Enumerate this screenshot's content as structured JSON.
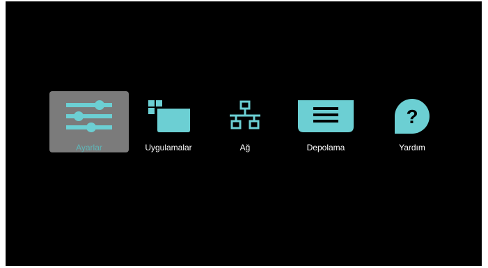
{
  "colors": {
    "background": "#000000",
    "accent": "#6ccfd3",
    "selected_bg": "#7b7b7b",
    "selected_label": "#5fb6b8",
    "label": "#ffffff"
  },
  "menu": {
    "selected_index": 0,
    "items": [
      {
        "label": "Ayarlar",
        "icon": "sliders-icon"
      },
      {
        "label": "Uygulamalar",
        "icon": "apps-icon"
      },
      {
        "label": "Ağ",
        "icon": "network-icon"
      },
      {
        "label": "Depolama",
        "icon": "storage-icon"
      },
      {
        "label": "Yardım",
        "icon": "help-icon"
      }
    ]
  }
}
